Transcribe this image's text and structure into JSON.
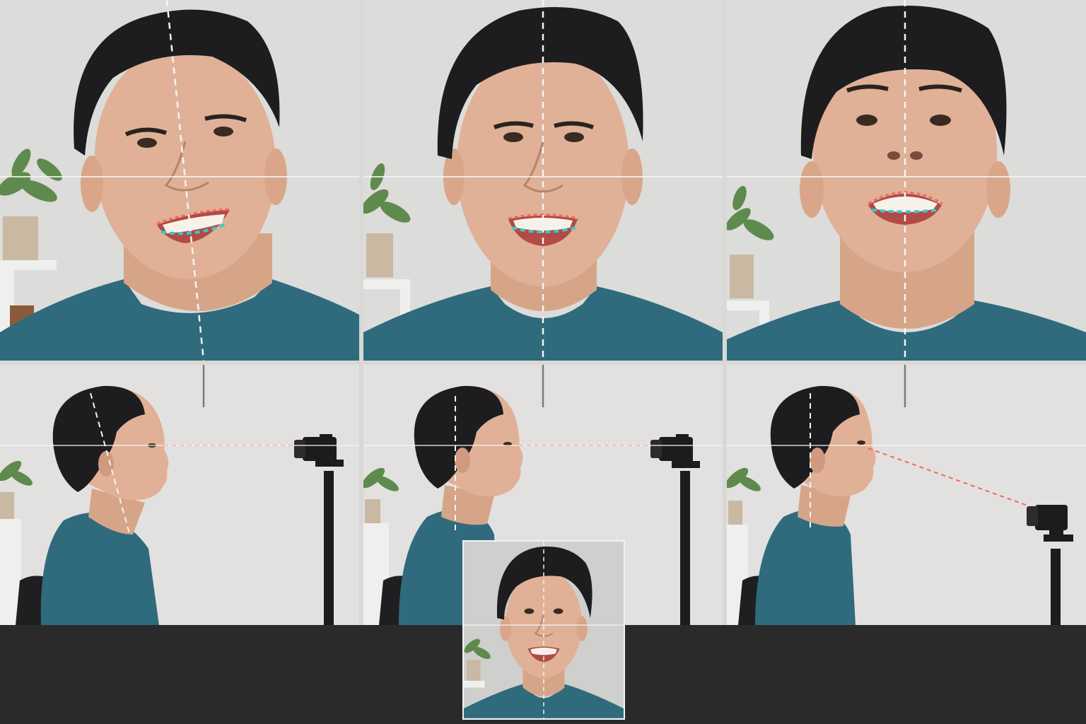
{
  "scene": {
    "colors": {
      "wall": "#dcdcda",
      "shirt": "#2f6b7c",
      "skin": "#e0b196",
      "hair": "#1d1d1f",
      "guide_line": "#f4f4f4",
      "gaze_line": "#f06a5c",
      "upper_lip_marker": "#f06a5c",
      "lower_lip_marker": "#38c8c8",
      "plant": "#5f8a4e",
      "camera": "#1c1c1c",
      "bar": "#2a2a2a"
    },
    "panels": [
      {
        "row": "front",
        "variant": "head-tilted",
        "marker_icons": [
          "upper-lip-curve",
          "lower-lip-curve"
        ]
      },
      {
        "row": "front",
        "variant": "head-level",
        "marker_icons": [
          "upper-lip-curve",
          "lower-lip-curve"
        ]
      },
      {
        "row": "front",
        "variant": "head-raised",
        "marker_icons": [
          "upper-lip-curve",
          "lower-lip-curve"
        ]
      },
      {
        "row": "side",
        "variant": "camera-eye-level",
        "icons": [
          "tripod-camera-icon",
          "gaze-line"
        ]
      },
      {
        "row": "side",
        "variant": "camera-eye-level",
        "icons": [
          "tripod-camera-icon",
          "gaze-line"
        ]
      },
      {
        "row": "side",
        "variant": "camera-low",
        "icons": [
          "tripod-camera-icon",
          "gaze-line"
        ]
      }
    ],
    "inset": {
      "variant": "reference-portrait"
    }
  }
}
